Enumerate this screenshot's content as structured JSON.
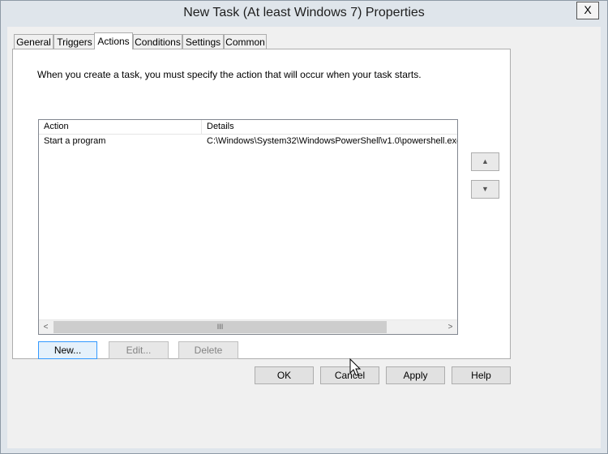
{
  "window": {
    "title": "New Task (At least Windows 7) Properties",
    "close_glyph": "X"
  },
  "tabs": [
    {
      "label": "General",
      "active": false
    },
    {
      "label": "Triggers",
      "active": false
    },
    {
      "label": "Actions",
      "active": true
    },
    {
      "label": "Conditions",
      "active": false
    },
    {
      "label": "Settings",
      "active": false
    },
    {
      "label": "Common",
      "active": false
    }
  ],
  "actions_tab": {
    "instruction": "When you create a task, you must specify the action that will occur when your task starts.",
    "columns": [
      "Action",
      "Details"
    ],
    "rows": [
      {
        "action": "Start a program",
        "details": "C:\\Windows\\System32\\WindowsPowerShell\\v1.0\\powershell.exe"
      }
    ],
    "scrollbar": {
      "thumb_grip": "III",
      "left_arrow": "<",
      "right_arrow": ">"
    },
    "move_up_glyph": "▲",
    "move_down_glyph": "▼",
    "buttons": {
      "new": "New...",
      "edit": "Edit...",
      "delete": "Delete"
    }
  },
  "dialog_buttons": {
    "ok": "OK",
    "cancel": "Cancel",
    "apply": "Apply",
    "help": "Help"
  }
}
